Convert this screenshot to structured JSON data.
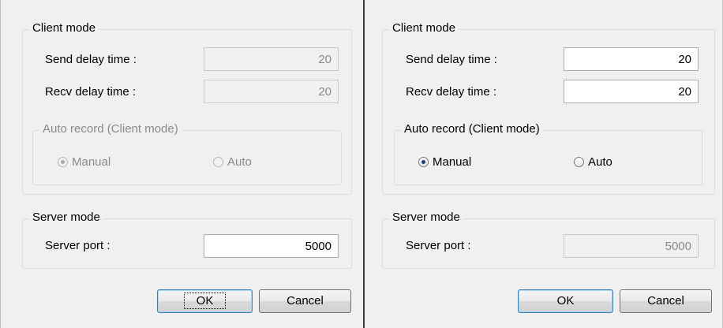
{
  "left": {
    "client_mode": {
      "legend": "Client mode",
      "send_delay_label": "Send delay time :",
      "send_delay_value": "20",
      "recv_delay_label": "Recv delay time :",
      "recv_delay_value": "20",
      "auto_record": {
        "legend": "Auto record (Client mode)",
        "manual_label": "Manual",
        "auto_label": "Auto",
        "selected": "Manual"
      }
    },
    "server_mode": {
      "legend": "Server mode",
      "port_label": "Server port :",
      "port_value": "5000"
    },
    "buttons": {
      "ok": "OK",
      "cancel": "Cancel"
    }
  },
  "right": {
    "client_mode": {
      "legend": "Client mode",
      "send_delay_label": "Send delay time :",
      "send_delay_value": "20",
      "recv_delay_label": "Recv delay time :",
      "recv_delay_value": "20",
      "auto_record": {
        "legend": "Auto record (Client mode)",
        "manual_label": "Manual",
        "auto_label": "Auto",
        "selected": "Manual"
      }
    },
    "server_mode": {
      "legend": "Server mode",
      "port_label": "Server port :",
      "port_value": "5000"
    },
    "buttons": {
      "ok": "OK",
      "cancel": "Cancel"
    }
  }
}
